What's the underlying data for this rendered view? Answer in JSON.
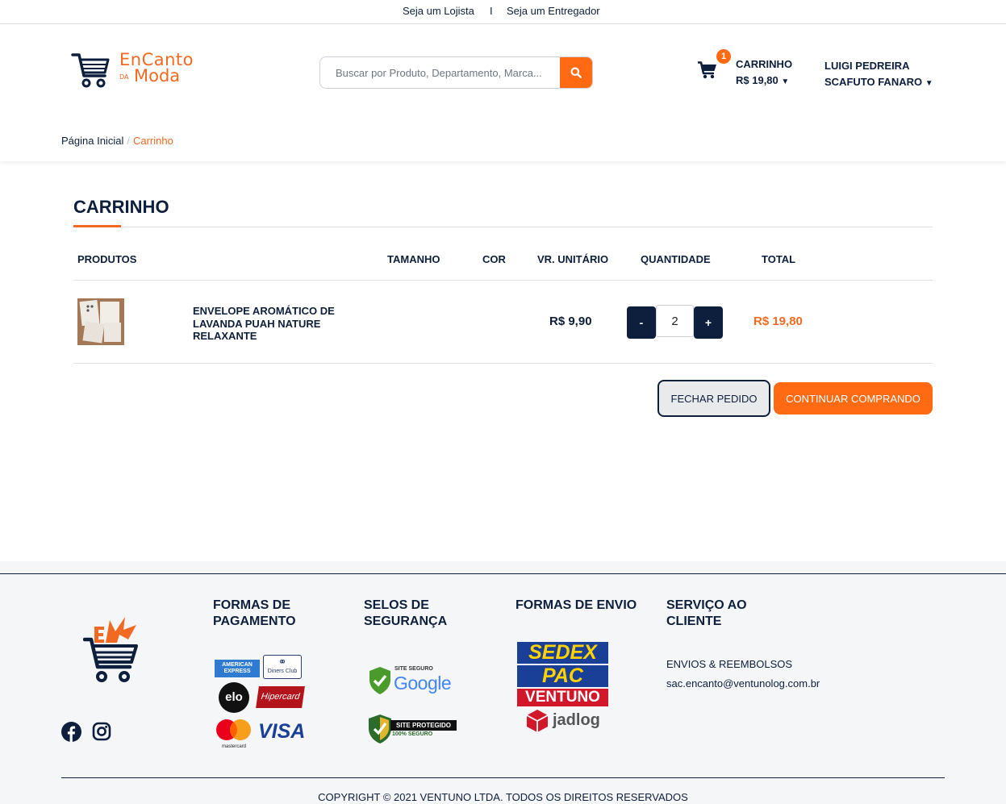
{
  "topbar": {
    "lojista": "Seja um Lojista",
    "separator": "I",
    "entregador": "Seja um Entregador"
  },
  "header": {
    "logo": {
      "line1": "EnCanto",
      "da": "DA",
      "line2": "Moda"
    },
    "search": {
      "placeholder": "Buscar por Produto, Departamento, Marca..."
    },
    "cart": {
      "count": "1",
      "label": "CARRINHO",
      "total": "R$ 19,80"
    },
    "user": {
      "line1": "LUIGI PEDREIRA",
      "line2": "SCAFUTO FANARO"
    }
  },
  "breadcrumb": {
    "home": "Página Inicial",
    "separator": "/",
    "current": "Carrinho"
  },
  "cart_page": {
    "title": "CARRINHO",
    "columns": [
      "PRODUTOS",
      "TAMANHO",
      "COR",
      "VR. UNITÁRIO",
      "QUANTIDADE",
      "TOTAL"
    ],
    "items": [
      {
        "name": "ENVELOPE AROMÁTICO DE LAVANDA PUAH NATURE RELAXANTE",
        "size": "",
        "color": "",
        "unit_price": "R$ 9,90",
        "quantity": "2",
        "total": "R$ 19,80"
      }
    ],
    "qty_minus": "-",
    "qty_plus": "+",
    "close_order": "FECHAR PEDIDO",
    "continue_shopping": "CONTINUAR COMPRANDO"
  },
  "footer": {
    "payment": {
      "heading_l1": "FORMAS DE",
      "heading_l2": "PAGAMENTO",
      "amex": "AMERICAN EXPRESS",
      "diners": "Diners Club",
      "elo": "elo",
      "hipercard": "Hipercard",
      "mastercard": "mastercard",
      "visa": "VISA"
    },
    "security": {
      "heading_l1": "SELOS DE",
      "heading_l2": "SEGURANÇA",
      "google_top": "SITE SEGURO",
      "google": "Google",
      "protected": "SITE PROTEGIDO",
      "protected_sub": "100% SEGURO"
    },
    "shipping": {
      "heading": "FORMAS DE ENVIO",
      "sedex": "SEDEX",
      "pac": "PAC",
      "ventuno": "VENTUNO",
      "jadlog": "jadlog"
    },
    "service": {
      "heading_l1": "SERVIÇO AO",
      "heading_l2": "CLIENTE",
      "link": "ENVIOS & REEMBOLSOS",
      "email": "sac.encanto@ventunolog.com.br"
    },
    "copyright": "COPYRIGHT © 2021 VENTUNO LTDA. TODOS OS DIREITOS RESERVADOS"
  },
  "colors": {
    "navy": "#0d1f3c",
    "orange": "#ff6a13",
    "accent_text": "#f26a21"
  }
}
